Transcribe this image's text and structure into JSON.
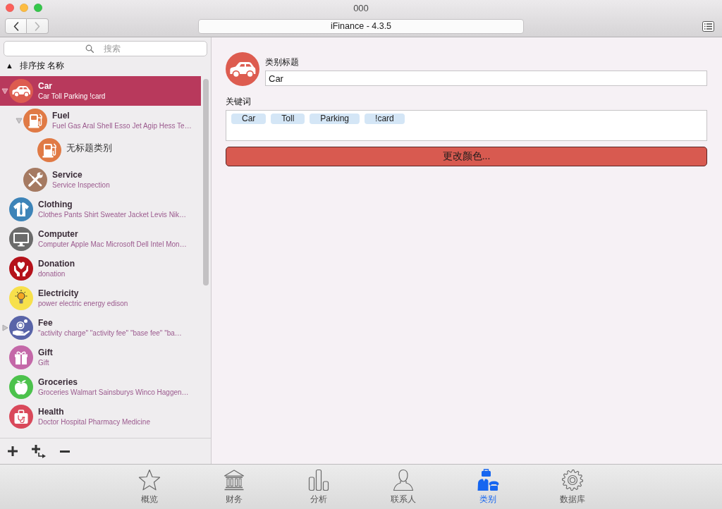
{
  "window": {
    "title": "000"
  },
  "toolbar": {
    "navigation": [
      {
        "kind": "back",
        "disabled": false
      },
      {
        "kind": "forward",
        "disabled": true
      }
    ],
    "title": "iFinance - 4.3.5"
  },
  "sidebar": {
    "search": {
      "placeholder": "搜索"
    },
    "sort": {
      "indicator": "▲",
      "label": "排序按 名称"
    },
    "categories": [
      {
        "kind": "car",
        "title": "Car",
        "keywords": "Car Toll Parking !card",
        "color": "#dd5c50",
        "selected": true,
        "expanded": true,
        "children": [
          {
            "kind": "fuel",
            "title": "Fuel",
            "keywords": "Fuel Gas Aral Shell Esso Jet Agip Hess Te…",
            "color": "#e07a45",
            "selected": false,
            "expanded": true,
            "children": [
              {
                "kind": "fuel",
                "title": "无标题类别",
                "color": "#e07a45",
                "selected": false
              }
            ]
          },
          {
            "kind": "tools",
            "title": "Service",
            "keywords": "Service Inspection",
            "color": "#a57a62",
            "selected": false
          }
        ]
      },
      {
        "kind": "shirt",
        "title": "Clothing",
        "keywords": "Clothes Pants Shirt Sweater Jacket Levis Nik…",
        "color": "#3d84b8",
        "selected": false
      },
      {
        "kind": "monitor",
        "title": "Computer",
        "keywords": "Computer Apple Mac Microsoft Dell Intel Mon…",
        "color": "#6b6b6b",
        "selected": false
      },
      {
        "kind": "heart",
        "title": "Donation",
        "keywords": "donation",
        "color": "#b5121b",
        "selected": false
      },
      {
        "kind": "bulb",
        "title": "Electricity",
        "keywords": "power electric energy edison",
        "color": "#f7e04b",
        "selected": false
      },
      {
        "kind": "money",
        "title": "Fee",
        "keywords": "\"activity charge\" \"activity fee\" \"base fee\" \"ba…",
        "color": "#5964a8",
        "selected": false,
        "expanded": false
      },
      {
        "kind": "gift",
        "title": "Gift",
        "keywords": "Gift",
        "color": "#c468a8",
        "selected": false
      },
      {
        "kind": "apple",
        "title": "Groceries",
        "keywords": "Groceries Walmart Sainsburys Winco Haggen…",
        "color": "#4cc24c",
        "selected": false
      },
      {
        "kind": "medkit",
        "title": "Health",
        "keywords": "Doctor Hospital Pharmacy Medicine",
        "color": "#d9485a",
        "selected": false
      }
    ],
    "actions": [
      {
        "kind": "add"
      },
      {
        "kind": "add_child"
      },
      {
        "kind": "remove"
      }
    ]
  },
  "detail": {
    "title_label": "类别标题",
    "title_value": "Car",
    "keywords_label": "关键词",
    "keywords": [
      "Car",
      "Toll",
      "Parking",
      "!card"
    ],
    "color_button": "更改颜色..."
  },
  "tabs": [
    {
      "kind": "star",
      "label": "概览",
      "selected": false
    },
    {
      "kind": "bank",
      "label": "财务",
      "selected": false
    },
    {
      "kind": "chart",
      "label": "分析",
      "selected": false
    },
    {
      "kind": "person",
      "label": "联系人",
      "selected": false
    },
    {
      "kind": "people",
      "label": "类别",
      "selected": true
    },
    {
      "kind": "gear",
      "label": "数据库",
      "selected": false
    }
  ]
}
